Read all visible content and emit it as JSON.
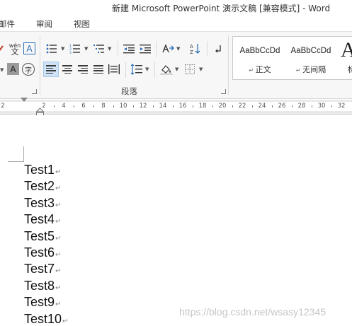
{
  "window": {
    "title": "新建 Microsoft PowerPoint 演示文稿 [兼容模式] - Word"
  },
  "tabs": [
    {
      "label": "邮件"
    },
    {
      "label": "审阅"
    },
    {
      "label": "视图"
    }
  ],
  "ribbon": {
    "font_group": {
      "phonetic_glyph_top": "wén",
      "phonetic_glyph_bottom": "文",
      "char_border_glyph": "A",
      "char_shading_glyph": "A",
      "enclose_glyph": "字"
    },
    "paragraph_group": {
      "label": "段落"
    },
    "styles": [
      {
        "sample": "AaBbCcDd",
        "name": "正文"
      },
      {
        "sample": "AaBbCcDd",
        "name": "无间隔"
      },
      {
        "sample": "A",
        "name": "标"
      }
    ]
  },
  "ruler": {
    "numbers": [
      "2",
      "2",
      "4",
      "6",
      "8",
      "10",
      "12",
      "14",
      "16",
      "18",
      "20",
      "22",
      "24",
      "26",
      "28",
      "30",
      "32"
    ]
  },
  "document": {
    "paragraph_mark": "↵",
    "paragraphs": [
      "Test1",
      "Test2",
      "Test3",
      "Test4",
      "Test5",
      "Test6",
      "Test7",
      "Test8",
      "Test9",
      "Test10"
    ]
  },
  "watermark": "https://blog.csdn.net/wsasy12345",
  "colors": {
    "active_button_bg": "#cfe2f6",
    "ribbon_bg": "#f7f7f7",
    "icon_blue": "#2b6cb8"
  }
}
